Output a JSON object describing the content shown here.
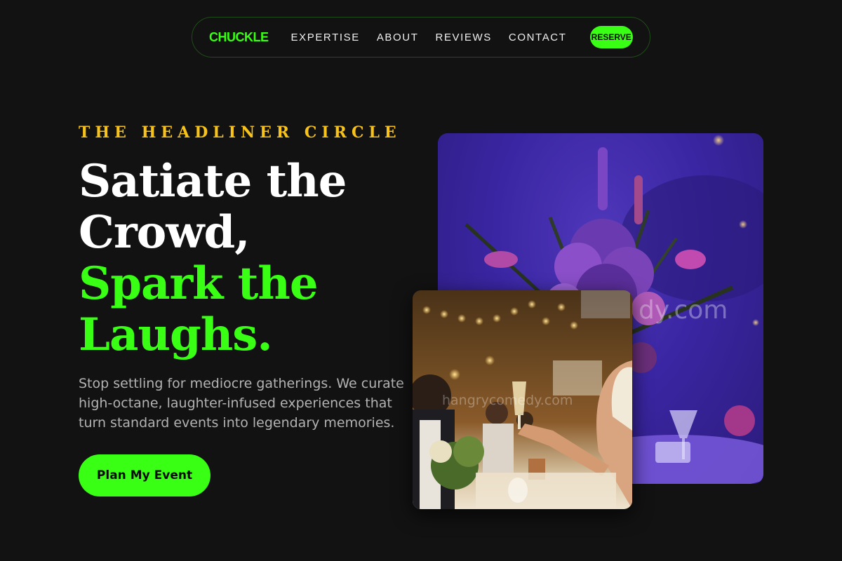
{
  "nav": {
    "logo": "CHUCKLE",
    "links": [
      "EXPERTISE",
      "ABOUT",
      "REVIEWS",
      "CONTACT"
    ],
    "reserve_label": "RESERVE"
  },
  "hero": {
    "eyebrow": "THE HEADLINER CIRCLE",
    "headline_line1": "Satiate the",
    "headline_line2": "Crowd,",
    "headline_line3": "Spark the",
    "headline_line4": "Laughs.",
    "description": "Stop settling for mediocre gatherings. We curate high-octane, laughter-infused experiences that turn standard events into legendary memories.",
    "cta_label": "Plan My Event"
  },
  "images": {
    "back_watermark": "dy.com",
    "front_watermark": "hangrycomedy.com"
  },
  "colors": {
    "accent": "#39ff14",
    "eyebrow": "#f7c21a",
    "background": "#121212"
  }
}
